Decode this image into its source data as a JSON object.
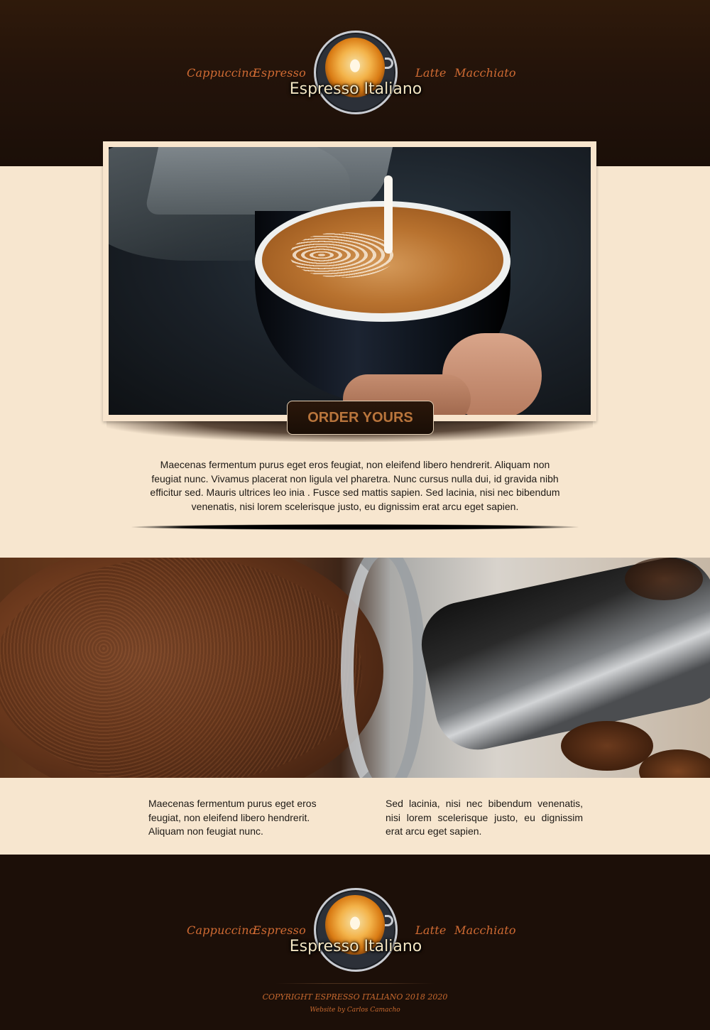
{
  "header": {
    "nav_left": [
      "Cappuccino",
      "Espresso"
    ],
    "nav_right": [
      "Latte",
      "Macchiato"
    ],
    "brand": "Espresso Italiano"
  },
  "hero": {
    "cta_label": "ORDER YOURS",
    "intro": "Maecenas fermentum purus eget eros feugiat, non eleifend libero hendrerit. Aliquam non feugiat nunc. Vivamus placerat non ligula vel pharetra. Nunc cursus nulla dui, id gravida nibh efficitur sed. Mauris ultrices leo inia . Fusce sed mattis sapien. Sed lacinia, nisi nec bibendum venenatis, nisi lorem scelerisque justo, eu dignissim erat arcu eget sapien."
  },
  "columns": {
    "left": "Maecenas fermentum purus eget eros feugiat, non eleifend libero hendrerit. Aliquam non feugiat nunc.",
    "right": "Sed lacinia, nisi nec bibendum venenatis, nisi lorem scelerisque justo, eu dignissim erat arcu eget sapien."
  },
  "footer": {
    "nav_left": [
      "Cappuccino",
      "Espresso"
    ],
    "nav_right": [
      "Latte",
      "Macchiato"
    ],
    "brand": "Espresso Italiano",
    "copyright": "COPYRIGHT ESPRESSO ITALIANO 2018 2020",
    "credit": "Website by Carlos Camacho"
  },
  "colors": {
    "dark_brown": "#1c0f08",
    "cream": "#f7e6cf",
    "nav_orange": "#d06b33",
    "cta_text": "#b9753c"
  }
}
